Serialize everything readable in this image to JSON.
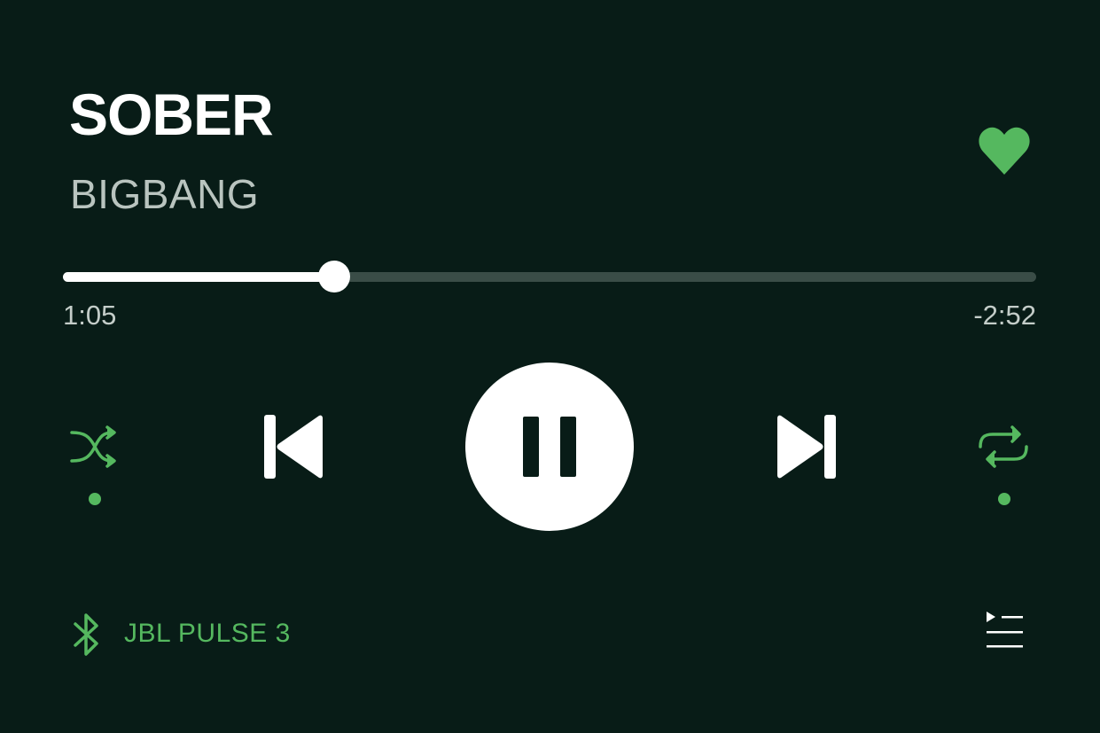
{
  "track": {
    "title": "SOBER",
    "artist": "BIGBANG",
    "liked": true
  },
  "progress": {
    "elapsed": "1:05",
    "remaining": "-2:52",
    "fraction": 0.279
  },
  "controls": {
    "shuffle_icon": "shuffle-icon",
    "shuffle_active": true,
    "previous_icon": "skip-previous-icon",
    "play_state_icon": "pause-icon",
    "next_icon": "skip-next-icon",
    "repeat_icon": "repeat-icon",
    "repeat_active": true
  },
  "device": {
    "icon": "bluetooth-icon",
    "name": "JBL PULSE 3"
  },
  "queue": {
    "icon": "queue-icon"
  },
  "colors": {
    "background": "#081c17",
    "accent": "#55b85f",
    "primary_text": "#ffffff",
    "secondary_text": "#b9c4bf",
    "track_bg": "#3a4d47"
  }
}
